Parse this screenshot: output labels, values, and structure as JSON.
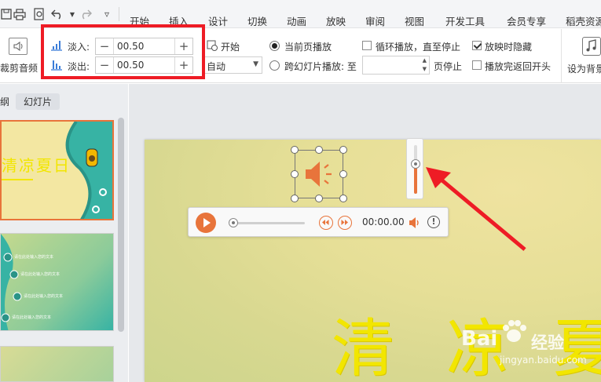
{
  "menubar": {
    "tabs": [
      "开始",
      "插入",
      "设计",
      "切换",
      "动画",
      "放映",
      "审阅",
      "视图",
      "开发工具",
      "会员专享",
      "稻壳资源"
    ]
  },
  "ribbon": {
    "trim_audio_label": "裁剪音频",
    "fade_in_label": "淡入:",
    "fade_in_value": "00.50",
    "fade_out_label": "淡出:",
    "fade_out_value": "00.50",
    "start_label": "开始",
    "start_value": "自动",
    "current_page_label": "当前页播放",
    "cross_slide_label": "跨幻灯片播放: 至",
    "page_stop_label": "页停止",
    "loop_label": "循环播放，直至停止",
    "hide_label": "放映时隐藏",
    "rewind_label": "播放完返回开头",
    "set_bg_label": "设为背景"
  },
  "left_pane": {
    "tabs": [
      "纲",
      "幻灯片"
    ],
    "slide1_title": "清凉夏日",
    "slide2_items": [
      "请在此处输入您的文本",
      "请在此处输入您的文本",
      "请在此处输入您的文本",
      "请在此处输入您的文本"
    ]
  },
  "player": {
    "time": "00:00.00"
  },
  "slide": {
    "title_chars": [
      "清",
      "凉",
      "夏"
    ]
  },
  "watermark": {
    "brand": "Bai",
    "brand_suffix": "经验",
    "url": "jingyan.baidu.com"
  },
  "colors": {
    "accent": "#e8743b",
    "highlight": "#ee1c25",
    "slide_title": "#f2e600"
  }
}
